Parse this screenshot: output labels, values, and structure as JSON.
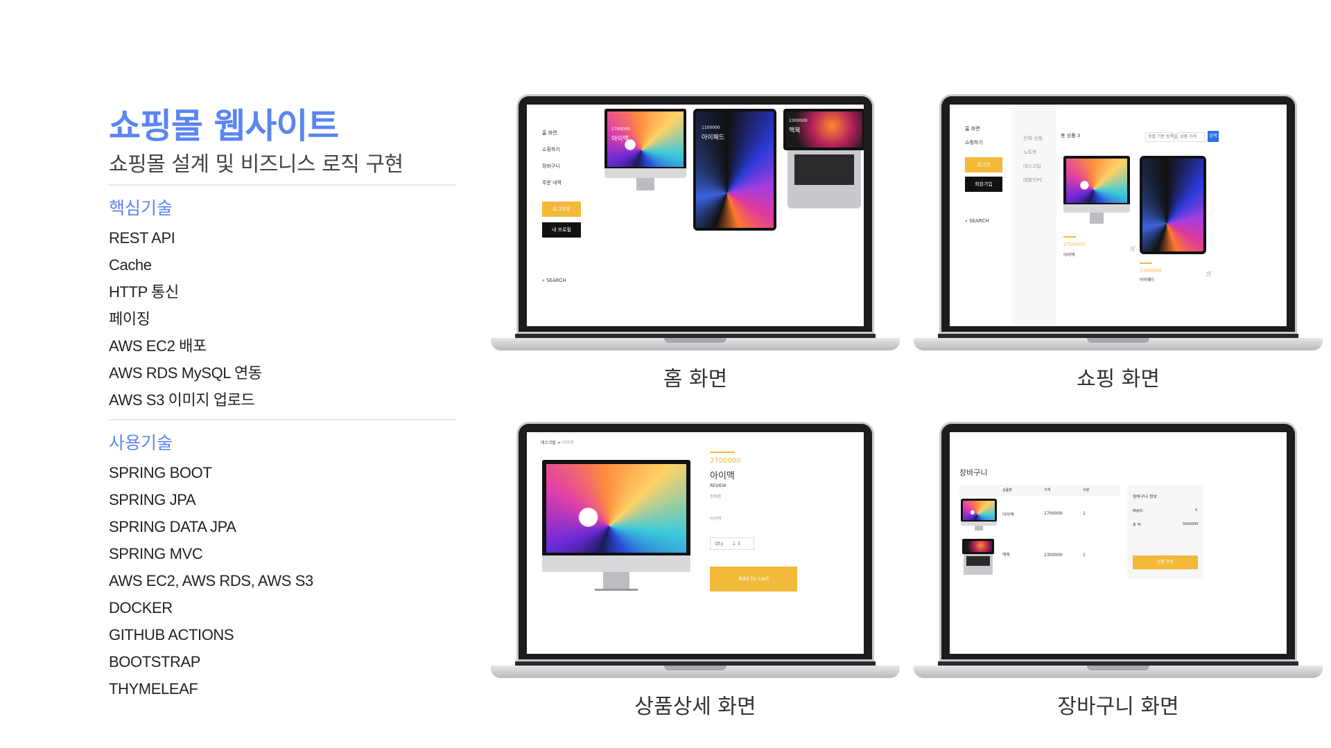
{
  "left": {
    "title": "쇼핑몰 웹사이트",
    "subtitle": "쇼핑몰 설계 및 비즈니스 로직 구현",
    "core_heading": "핵심기술",
    "core_items": [
      "REST API",
      "Cache",
      "HTTP 통신",
      "페이징",
      "AWS EC2 배포",
      "AWS RDS MySQL 연동",
      "AWS S3 이미지 업로드"
    ],
    "used_heading": "사용기술",
    "used_items": [
      "SPRING BOOT",
      "SPRING JPA",
      "SPRING DATA JPA",
      "SPRING MVC",
      "AWS EC2, AWS RDS, AWS S3",
      "DOCKER",
      "GITHUB ACTIONS",
      "BOOTSTRAP",
      "THYMELEAF"
    ]
  },
  "colors": {
    "accent": "#5a85f2",
    "button_yellow": "#f2b93b",
    "button_black": "#111111",
    "search_blue": "#2f6fe0"
  },
  "captions": {
    "home": "홈 화면",
    "shop": "쇼핑 화면",
    "detail": "상품상세 화면",
    "cart": "장바구니 화면"
  },
  "home_screen": {
    "nav": [
      "홈 화면",
      "쇼핑하기",
      "장바구니",
      "주문 내역"
    ],
    "login_button": "로그아웃",
    "profile_button": "내 프로필",
    "search_label": "SEARCH",
    "tile_labels": [
      "아이맥",
      "아이패드",
      "맥북"
    ],
    "tile_prices": [
      "2700000",
      "1100000",
      "2300000"
    ]
  },
  "shop_screen": {
    "nav": [
      "홈 화면",
      "쇼핑하기"
    ],
    "login_button": "로그인",
    "signup_button": "회원가입",
    "search_label": "SEARCH",
    "categories": [
      "전체 상품",
      "노트북",
      "데스크탑",
      "태블릿PC"
    ],
    "count_label": "총 상품 3",
    "sort_a": "정렬 기준",
    "sort_a_value": "등록일",
    "sort_b": "상품 가격",
    "search_button": "검색",
    "items": [
      {
        "price": "2700000",
        "name": "아이맥"
      },
      {
        "price": "1100000",
        "name": "아이패드"
      }
    ]
  },
  "detail_screen": {
    "breadcrumb": [
      "데스크탑",
      "아이맥"
    ],
    "price": "2700000",
    "name": "아이맥",
    "review_label": "REVIEW",
    "review_sub": "판매중",
    "desc": "아이맥",
    "qty_label": "Qty",
    "qty_value": "1",
    "add_to_cart": "Add to cart"
  },
  "cart_screen": {
    "title": "장바구니",
    "headers": [
      "상품명",
      "가격",
      "수량"
    ],
    "rows": [
      {
        "name": "아이맥",
        "price": "2700000",
        "qty": "1"
      },
      {
        "name": "맥북",
        "price": "2300000",
        "qty": "1"
      }
    ],
    "info_title": "장바구니 정보",
    "shipping_label": "배송비:",
    "shipping_value": "0",
    "total_label": "총 액:",
    "total_value": "5000000",
    "order_button": "상품 주문"
  }
}
